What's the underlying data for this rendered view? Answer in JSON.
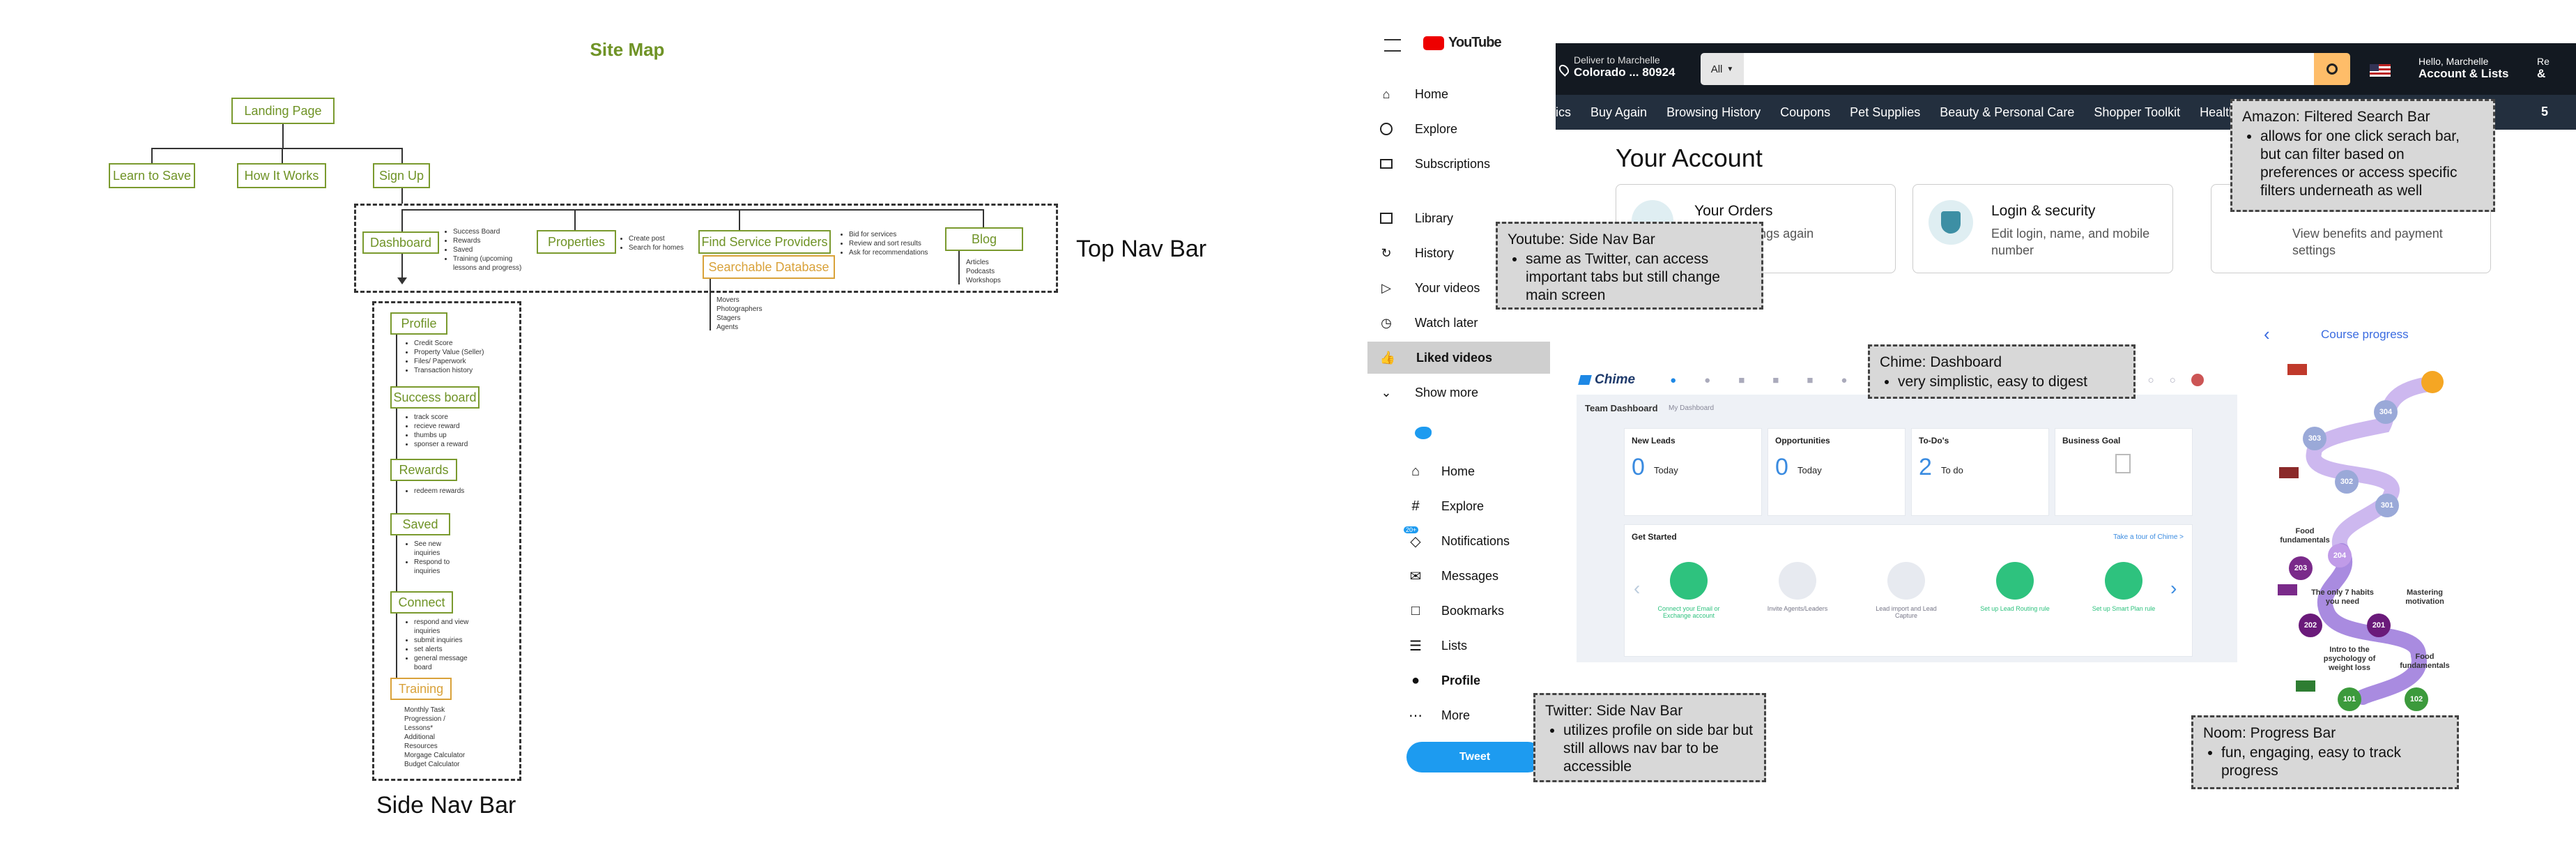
{
  "sitemap": {
    "title": "Site Map",
    "landing": "Landing Page",
    "learn": "Learn to Save",
    "how": "How It Works",
    "signup": "Sign Up",
    "dashboard": "Dashboard",
    "dashboard_items": [
      "Success Board",
      "Rewards",
      "Saved",
      "Training (upcoming",
      "lessons and progress)"
    ],
    "properties": "Properties",
    "properties_items": [
      "Create post",
      "Search for homes"
    ],
    "find": "Find Service Providers",
    "find_items": [
      "Bid for services",
      "Review and sort results",
      "Ask for recommendations"
    ],
    "searchable": "Searchable Database",
    "searchable_items": [
      "Movers",
      "Photographers",
      "Stagers",
      "Agents"
    ],
    "blog": "Blog",
    "blog_items": [
      "Articles",
      "Podcasts",
      "Workshops"
    ],
    "top_nav_label": "Top Nav Bar",
    "side_nav_label": "Side Nav Bar",
    "profile": "Profile",
    "profile_items": [
      "Credit Score",
      "Property Value (Seller)",
      "Files/ Paperwork",
      "Transaction history"
    ],
    "success": "Success board",
    "success_items": [
      "track score",
      "recieve reward",
      "thumbs up",
      "sponser a reward"
    ],
    "rewards": "Rewards",
    "rewards_items": [
      "redeem rewards"
    ],
    "saved": "Saved",
    "saved_items": [
      "See new",
      "inquiries",
      "Respond to",
      "inquiries"
    ],
    "connect": "Connect",
    "connect_items": [
      "respond and view",
      "inquiries",
      "submit inquiries",
      "set alerts",
      "general message",
      "board"
    ],
    "training": "Training",
    "training_items": [
      "Monthly Task",
      "Progression /",
      "Lessons*",
      "Additional",
      "Resources",
      "Morgage Calculator",
      "Budget Calculator"
    ]
  },
  "youtube": {
    "logo": "YouTube",
    "items": [
      {
        "label": "Home",
        "icon": "home-icon"
      },
      {
        "label": "Explore",
        "icon": "compass-icon"
      },
      {
        "label": "Subscriptions",
        "icon": "subscriptions-icon"
      },
      {
        "label": "Library",
        "icon": "library-icon"
      },
      {
        "label": "History",
        "icon": "history-icon"
      },
      {
        "label": "Your videos",
        "icon": "play-icon"
      },
      {
        "label": "Watch later",
        "icon": "clock-icon"
      },
      {
        "label": "Liked videos",
        "icon": "thumbs-up-icon"
      },
      {
        "label": "Show more",
        "icon": "chevron-down-icon"
      }
    ]
  },
  "twitter": {
    "items": [
      {
        "label": "Home",
        "icon": "home-icon"
      },
      {
        "label": "Explore",
        "icon": "hashtag-icon"
      },
      {
        "label": "Notifications",
        "icon": "bell-icon",
        "badge": "20+"
      },
      {
        "label": "Messages",
        "icon": "mail-icon"
      },
      {
        "label": "Bookmarks",
        "icon": "bookmark-icon"
      },
      {
        "label": "Lists",
        "icon": "list-icon"
      },
      {
        "label": "Profile",
        "icon": "user-icon"
      },
      {
        "label": "More",
        "icon": "more-icon"
      }
    ],
    "tweet": "Tweet"
  },
  "amazon": {
    "deliver_line1": "Deliver to Marchelle",
    "deliver_line2": "Colorado ... 80924",
    "search_category": "All",
    "hello": "Hello, Marchelle",
    "account_lists": "Account & Lists",
    "returns": "Re",
    "returns2": "&",
    "nav": [
      "ics",
      "Buy Again",
      "Browsing History",
      "Coupons",
      "Pet Supplies",
      "Beauty & Personal Care",
      "Shopper Toolkit",
      "Health &"
    ],
    "nav_end": "5",
    "page_title": "Your Account",
    "orders_title": "Your Orders",
    "orders_sub": "s, or buy things again",
    "login_title": "Login & security",
    "login_sub1": "Edit login, name, and mobile",
    "login_sub2": "number",
    "prime_sub1": "View benefits and payment",
    "prime_sub2": "settings"
  },
  "chime": {
    "logo": "Chime",
    "team": "Team Dashboard",
    "my": "My Dashboard",
    "cards": [
      {
        "title": "New Leads",
        "num": "0",
        "unit": "Today"
      },
      {
        "title": "Opportunities",
        "num": "0",
        "unit": "Today"
      },
      {
        "title": "To-Do's",
        "num": "2",
        "unit": "To do"
      },
      {
        "title": "Business Goal",
        "num": "",
        "unit": ""
      }
    ],
    "get_started": "Get Started",
    "tour": "Take a tour of Chime >",
    "steps": [
      "Connect your Email or Exchange account",
      "Invite Agents/Leaders",
      "Lead import and Lead Capture",
      "Set up Lead Routing rule",
      "Set up Smart Plan rule"
    ]
  },
  "noom": {
    "header": "Course progress",
    "nodes": [
      "101",
      "102",
      "201",
      "202",
      "203",
      "204",
      "301",
      "302",
      "303",
      "304"
    ],
    "labels": [
      "Food fundamentals",
      "Intro to the psychology of weight loss",
      "Mastering motivation",
      "The only 7 habits you need",
      "Food fundamentals"
    ]
  },
  "notes": {
    "youtube": {
      "title": "Youtube: Side Nav Bar",
      "bullets": [
        "same as Twitter, can access important tabs but still change main screen"
      ]
    },
    "amazon": {
      "title": "Amazon: Filtered Search Bar",
      "bullets": [
        "allows for one click serach bar, but can filter based on preferences or access specific filters underneath as well"
      ]
    },
    "chime": {
      "title": "Chime: Dashboard",
      "bullets": [
        "very simplistic, easy to digest"
      ]
    },
    "twitter": {
      "title": "Twitter: Side Nav Bar",
      "bullets": [
        "utilizes profile on side bar but still allows nav bar to be accessible"
      ]
    },
    "noom": {
      "title": "Noom: Progress Bar",
      "bullets": [
        "fun, engaging, easy to track progress"
      ]
    }
  },
  "colors": {
    "sitemap_green": "#6f9326",
    "sitemap_orange": "#d9a23a",
    "amazon_dark": "#131921",
    "amazon_nav": "#232f3e",
    "twitter_blue": "#1d9bf0",
    "chime_green": "#2ec27e",
    "noom_purple": "#a98be0"
  }
}
